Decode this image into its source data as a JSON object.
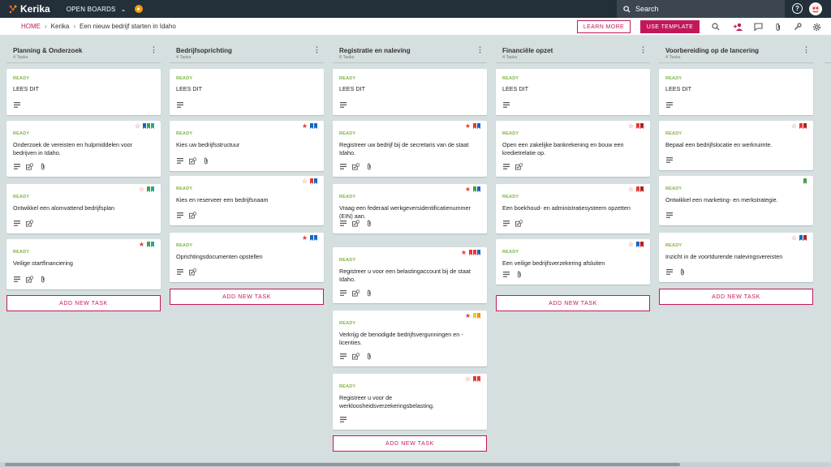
{
  "app": {
    "name": "Kerika",
    "open_boards": "OPEN BOARDS"
  },
  "search": {
    "placeholder": "Search"
  },
  "breadcrumb": {
    "home": "HOME",
    "org": "Kerika",
    "board": "Een nieuw bedrijf starten in Idaho"
  },
  "toolbar": {
    "learn_more": "LEARN MORE",
    "use_template": "USE TEMPLATE"
  },
  "colors": {
    "accent": "#c2185b",
    "ready": "#7cb342",
    "red": "#e53935",
    "blue": "#1565c0",
    "green": "#43a047",
    "teal": "#26a69a",
    "darkred": "#b71c1c",
    "orange": "#fb8c00",
    "yellow": "#fbc02d"
  },
  "add_task_label": "ADD NEW TASK",
  "columns": [
    {
      "title": "Planning & Onderzoek",
      "count": "4 Tasks",
      "cards": [
        {
          "status": "READY",
          "title": "LEES DIT"
        },
        {
          "status": "READY",
          "title": "Onderzoek de vereisten en hulpmiddelen voor bedrijven in Idaho."
        },
        {
          "status": "READY",
          "title": "Ontwikkel een alomvattend bedrijfsplan"
        },
        {
          "status": "READY",
          "title": "Veilige startfinanciering"
        }
      ]
    },
    {
      "title": "Bedrijfsoprichting",
      "count": "4 Tasks",
      "cards": [
        {
          "status": "READY",
          "title": "LEES DIT"
        },
        {
          "status": "READY",
          "title": "Kies uw bedrijfsstructuur"
        },
        {
          "status": "READY",
          "title": "Kies en reserveer een bedrijfsnaam"
        },
        {
          "status": "READY",
          "title": "Oprichtingsdocumenten opstellen"
        }
      ]
    },
    {
      "title": "Registratie en naleving",
      "count": "6 Tasks",
      "cards": [
        {
          "status": "READY",
          "title": "LEES DIT"
        },
        {
          "status": "READY",
          "title": "Registreer uw bedrijf bij de secretaris van de staat Idaho."
        },
        {
          "status": "READY",
          "title": "Vraag een federaal werkgeversidentificatienummer (EIN) aan."
        },
        {
          "status": "READY",
          "title": "Registreer u voor een belastingaccount bij de staat Idaho."
        },
        {
          "status": "READY",
          "title": "Verkrijg de benodigde bedrijfsvergunningen en -licenties."
        },
        {
          "status": "READY",
          "title": "Registreer u voor de werkloosheidsverzekeringsbelasting."
        }
      ]
    },
    {
      "title": "Financiële opzet",
      "count": "4 Tasks",
      "cards": [
        {
          "status": "READY",
          "title": "LEES DIT"
        },
        {
          "status": "READY",
          "title": "Open een zakelijke bankrekening en bouw een kredietrelatie op."
        },
        {
          "status": "READY",
          "title": "Een boekhoud- en administratiesysteem opzetten"
        },
        {
          "status": "READY",
          "title": "Een veilige bedrijfsverzekering afsluiten"
        }
      ]
    },
    {
      "title": "Voorbereiding op de lancering",
      "count": "4 Tasks",
      "cards": [
        {
          "status": "READY",
          "title": "LEES DIT"
        },
        {
          "status": "READY",
          "title": "Bepaal een bedrijfslocatie en werkruimte."
        },
        {
          "status": "READY",
          "title": "Ontwikkel een marketing- en merkstrategie."
        },
        {
          "status": "READY",
          "title": "Inzicht in de voortdurende nalevingsvereisten"
        }
      ]
    }
  ]
}
